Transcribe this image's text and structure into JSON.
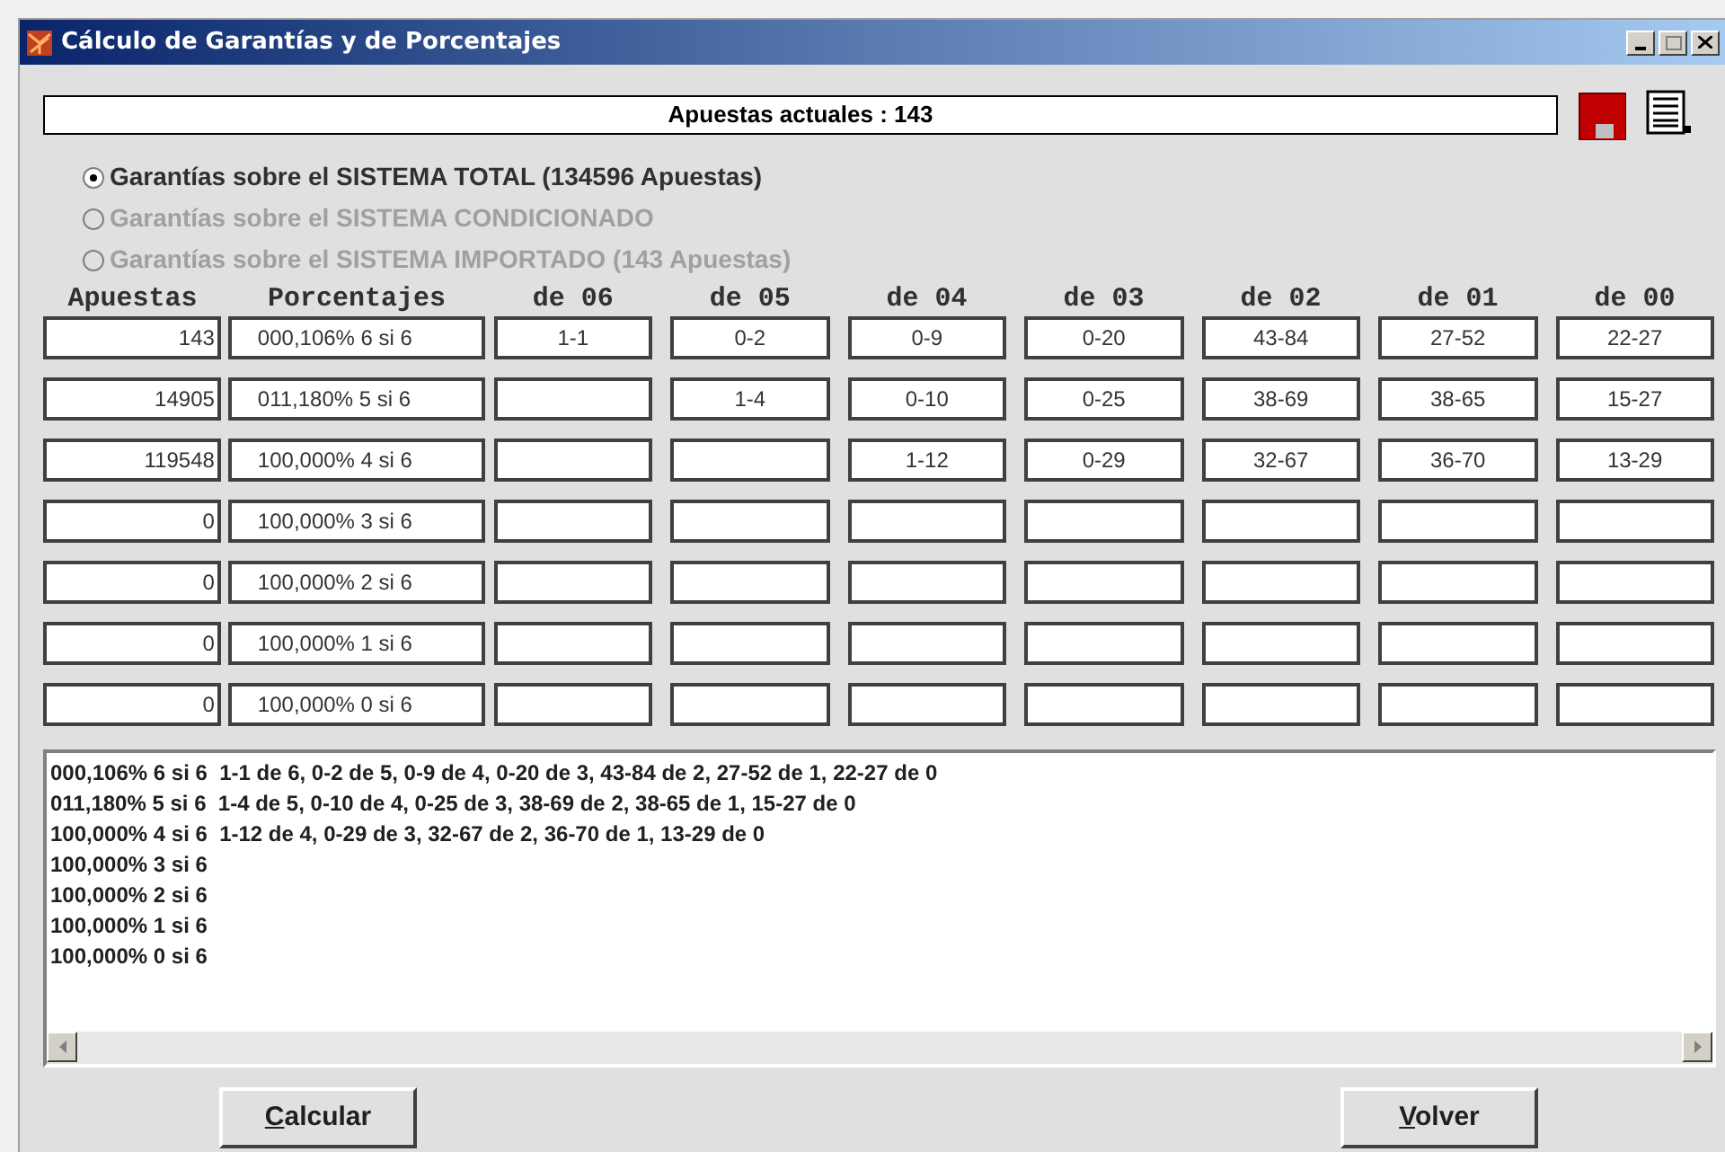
{
  "window": {
    "title": "Cálculo de Garantías y de Porcentajes"
  },
  "summary": "Apuestas actuales : 143",
  "options": [
    {
      "label": "Garantías sobre el SISTEMA TOTAL (134596 Apuestas)",
      "selected": true,
      "disabled": false
    },
    {
      "label": "Garantías sobre el SISTEMA CONDICIONADO",
      "selected": false,
      "disabled": true
    },
    {
      "label": "Garantías sobre el SISTEMA IMPORTADO (143 Apuestas)",
      "selected": false,
      "disabled": true
    }
  ],
  "columns": [
    "Apuestas",
    "Porcentajes",
    "de 06",
    "de 05",
    "de 04",
    "de 03",
    "de 02",
    "de 01",
    "de 00"
  ],
  "rows": [
    {
      "apuestas": "143",
      "porcentaje": "000,106% 6 si 6",
      "cells": [
        "1-1",
        "0-2",
        "0-9",
        "0-20",
        "43-84",
        "27-52",
        "22-27"
      ]
    },
    {
      "apuestas": "14905",
      "porcentaje": "011,180% 5 si 6",
      "cells": [
        "",
        "1-4",
        "0-10",
        "0-25",
        "38-69",
        "38-65",
        "15-27"
      ]
    },
    {
      "apuestas": "119548",
      "porcentaje": "100,000% 4 si 6",
      "cells": [
        "",
        "",
        "1-12",
        "0-29",
        "32-67",
        "36-70",
        "13-29"
      ]
    },
    {
      "apuestas": "0",
      "porcentaje": "100,000% 3 si 6",
      "cells": [
        "",
        "",
        "",
        "",
        "",
        "",
        ""
      ]
    },
    {
      "apuestas": "0",
      "porcentaje": "100,000% 2 si 6",
      "cells": [
        "",
        "",
        "",
        "",
        "",
        "",
        ""
      ]
    },
    {
      "apuestas": "0",
      "porcentaje": "100,000% 1 si 6",
      "cells": [
        "",
        "",
        "",
        "",
        "",
        "",
        ""
      ]
    },
    {
      "apuestas": "0",
      "porcentaje": "100,000% 0 si 6",
      "cells": [
        "",
        "",
        "",
        "",
        "",
        "",
        ""
      ]
    }
  ],
  "output_lines": [
    "000,106% 6 si 6  1-1 de 6, 0-2 de 5, 0-9 de 4, 0-20 de 3, 43-84 de 2, 27-52 de 1, 22-27 de 0",
    "011,180% 5 si 6  1-4 de 5, 0-10 de 4, 0-25 de 3, 38-69 de 2, 38-65 de 1, 15-27 de 0",
    "100,000% 4 si 6  1-12 de 4, 0-29 de 3, 32-67 de 2, 36-70 de 1, 13-29 de 0",
    "100,000% 3 si 6",
    "100,000% 2 si 6",
    "100,000% 1 si 6",
    "100,000% 0 si 6"
  ],
  "buttons": [
    {
      "label": "Calcular"
    },
    {
      "label": "Volver"
    }
  ]
}
